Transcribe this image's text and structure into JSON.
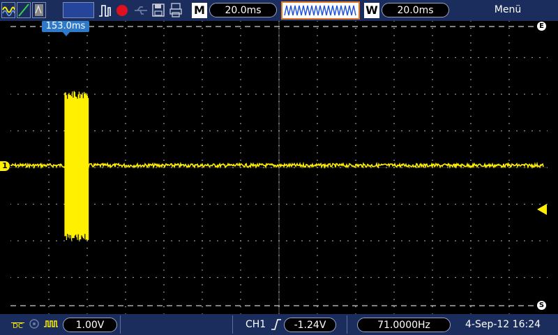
{
  "top_bar": {
    "m_label": "M",
    "m_timebase": "20.0ms",
    "w_label": "W",
    "w_timebase": "20.0ms",
    "menu_label": "Menü"
  },
  "plot": {
    "time_marker": "153.0ms",
    "channel_marker": "1",
    "top_marker": "E",
    "bottom_marker": "S",
    "trace_color": "#ffef00",
    "grid_color": "#c8c8c8"
  },
  "bottom_bar": {
    "coupling_label": "DC",
    "volts_div": "1.00V",
    "channel": "CH1",
    "trigger_level": "-1.24V",
    "frequency": "71.0000Hz",
    "datetime": "4-Sep-12 16:24"
  },
  "colors": {
    "bar_bg": "#1b2d5c",
    "accent_orange": "#e07a2c",
    "record_red": "#e0101e",
    "trigger_arrow": "#ffef00"
  }
}
